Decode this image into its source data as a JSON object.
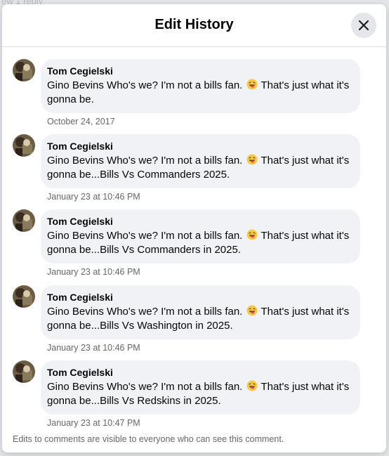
{
  "backdrop": {
    "partial_text": "ew 1 reply"
  },
  "modal": {
    "title": "Edit History",
    "close_icon": "close-icon"
  },
  "history": [
    {
      "author": "Tom Cegielski",
      "text_before_emoji": "Gino Bevins Who's we? I'm not a bills fan.",
      "emoji": "grinning-squinting-tongue-emoji",
      "text_after_emoji": "That's just what it's gonna be.",
      "timestamp": "October 24, 2017"
    },
    {
      "author": "Tom Cegielski",
      "text_before_emoji": "Gino Bevins Who's we? I'm not a bills fan.",
      "emoji": "grinning-squinting-tongue-emoji",
      "text_after_emoji": "That's just what it's gonna be...Bills Vs Commanders 2025.",
      "timestamp": "January 23 at 10:46 PM"
    },
    {
      "author": "Tom Cegielski",
      "text_before_emoji": "Gino Bevins Who's we? I'm not a bills fan.",
      "emoji": "grinning-squinting-tongue-emoji",
      "text_after_emoji": "That's just what it's gonna be...Bills Vs Commanders in 2025.",
      "timestamp": "January 23 at 10:46 PM"
    },
    {
      "author": "Tom Cegielski",
      "text_before_emoji": "Gino Bevins Who's we? I'm not a bills fan.",
      "emoji": "grinning-squinting-tongue-emoji",
      "text_after_emoji": "That's just what it's gonna be...Bills Vs Washington in 2025.",
      "timestamp": "January 23 at 10:46 PM"
    },
    {
      "author": "Tom Cegielski",
      "text_before_emoji": "Gino Bevins Who's we? I'm not a bills fan.",
      "emoji": "grinning-squinting-tongue-emoji",
      "text_after_emoji": "That's just what it's gonna be...Bills Vs Redskins in 2025.",
      "timestamp": "January 23 at 10:47 PM"
    }
  ],
  "footer": {
    "note": "Edits to comments are visible to everyone who can see this comment."
  },
  "colors": {
    "bubble_bg": "#f0f2f5",
    "text": "#050505",
    "secondary_text": "#65676b",
    "close_button_bg": "#e4e6eb"
  }
}
